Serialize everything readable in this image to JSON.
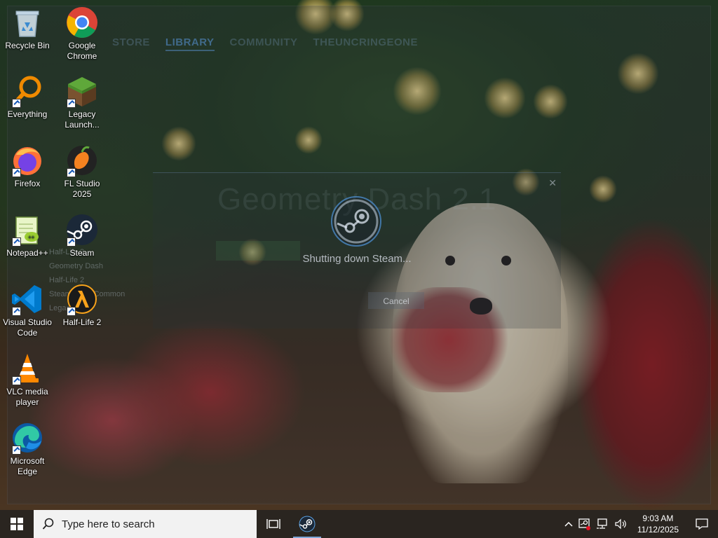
{
  "steam_overlay": {
    "nav": [
      "STORE",
      "LIBRARY",
      "COMMUNITY",
      "THEUNCRINGEONE"
    ],
    "ghost_title": "Geometry Dash 2.1",
    "ghost_list": [
      "Half-Life 2",
      "Geometry Dash",
      "Half-Life 2",
      "Steamworks Common",
      "Legacy Play"
    ]
  },
  "dialog": {
    "status_text": "Shutting down Steam...",
    "cancel_label": "Cancel"
  },
  "desktop_icons": [
    {
      "label": "Recycle Bin",
      "icon": "recycle-bin-icon"
    },
    {
      "label": "Google Chrome",
      "icon": "chrome-icon"
    },
    {
      "label": "Everything",
      "icon": "everything-icon"
    },
    {
      "label": "Legacy Launch...",
      "icon": "legacy-launcher-icon"
    },
    {
      "label": "Firefox",
      "icon": "firefox-icon"
    },
    {
      "label": "FL Studio 2025",
      "icon": "fl-studio-icon"
    },
    {
      "label": "Notepad++",
      "icon": "notepad-plus-plus-icon"
    },
    {
      "label": "Steam",
      "icon": "steam-icon"
    },
    {
      "label": "Visual Studio Code",
      "icon": "vscode-icon"
    },
    {
      "label": "Half-Life 2",
      "icon": "half-life-2-icon"
    },
    {
      "label": "VLC media player",
      "icon": "vlc-icon"
    },
    {
      "label": "Microsoft Edge",
      "icon": "edge-icon"
    }
  ],
  "taskbar": {
    "search_placeholder": "Type here to search",
    "time": "9:03 AM",
    "date": "11/12/2025"
  },
  "colors": {
    "taskbar_bg": "#2a2520",
    "search_bg": "#f2f2f2",
    "steam_blue": "#1b75bc"
  }
}
